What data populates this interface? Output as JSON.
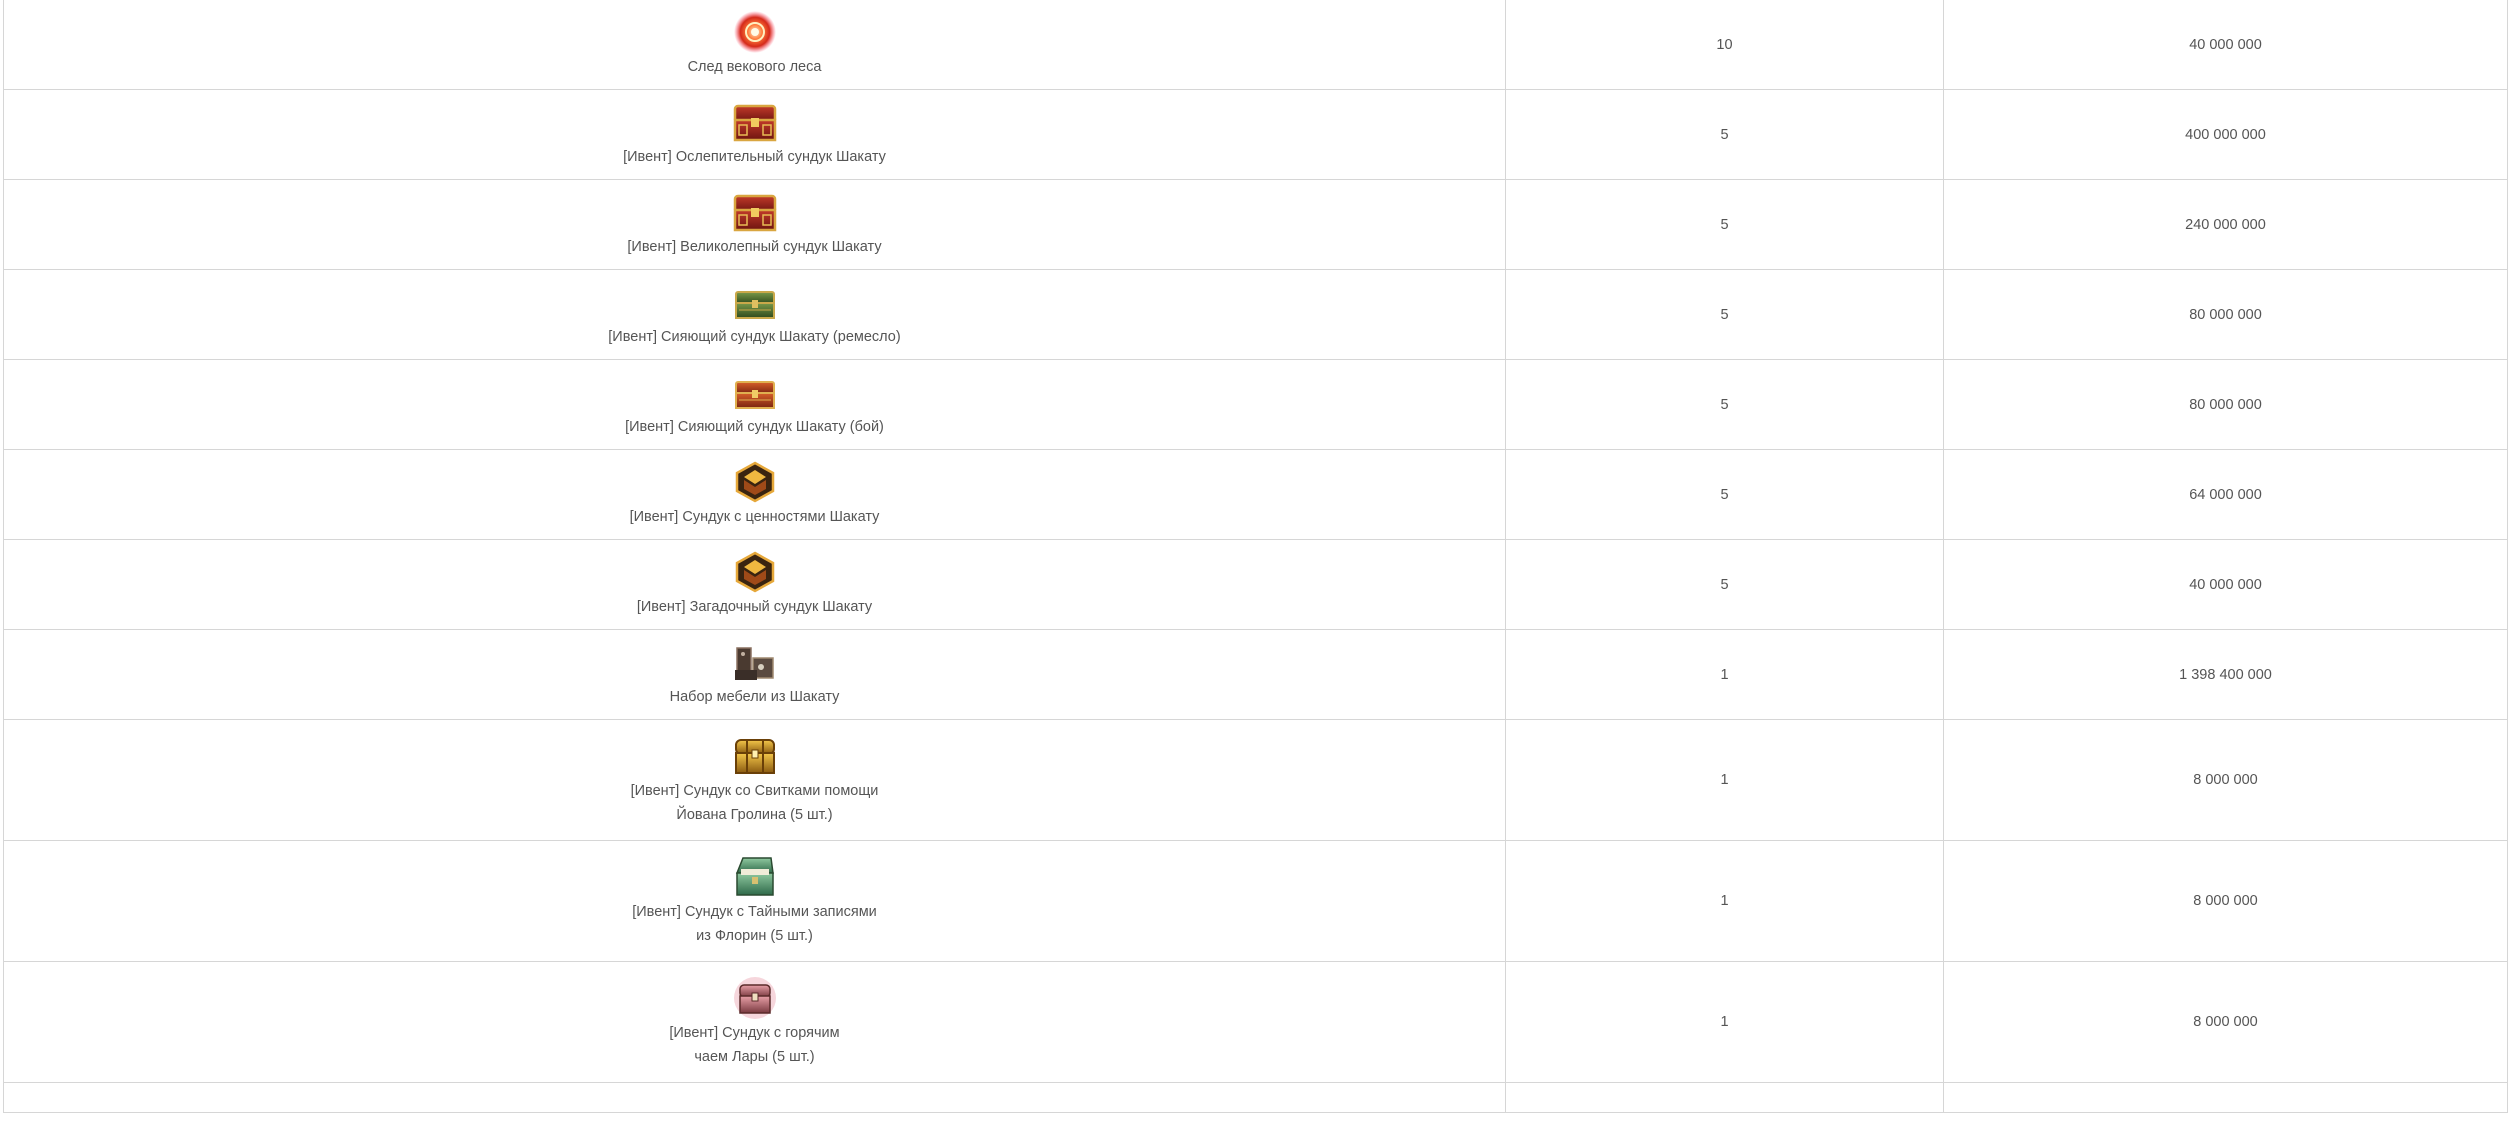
{
  "items": [
    {
      "name": "След векового леса",
      "name2": "",
      "qty": "10",
      "price": "40 000 000",
      "icon": "flame-orb-icon",
      "tall": false
    },
    {
      "name": "[Ивент] Ослепительный сундук Шакату",
      "name2": "",
      "qty": "5",
      "price": "400 000 000",
      "icon": "red-gold-chest-icon",
      "tall": false
    },
    {
      "name": "[Ивент] Великолепный сундук Шакату",
      "name2": "",
      "qty": "5",
      "price": "240 000 000",
      "icon": "red-gold-chest-icon",
      "tall": false
    },
    {
      "name": "[Ивент] Сияющий сундук Шакату (ремесло)",
      "name2": "",
      "qty": "5",
      "price": "80 000 000",
      "icon": "green-chest-icon",
      "tall": false
    },
    {
      "name": "[Ивент] Сияющий сундук Шакату (бой)",
      "name2": "",
      "qty": "5",
      "price": "80 000 000",
      "icon": "orange-chest-icon",
      "tall": false
    },
    {
      "name": "[Ивент] Сундук с ценностями Шакату",
      "name2": "",
      "qty": "5",
      "price": "64 000 000",
      "icon": "hex-chest-icon",
      "tall": false
    },
    {
      "name": "[Ивент] Загадочный сундук Шакату",
      "name2": "",
      "qty": "5",
      "price": "40 000 000",
      "icon": "hex-chest-icon",
      "tall": false
    },
    {
      "name": "Набор мебели из Шакату",
      "name2": "",
      "qty": "1",
      "price": "1 398 400 000",
      "icon": "furniture-set-icon",
      "tall": false
    },
    {
      "name": "[Ивент] Сундук со Свитками помощи",
      "name2": "Йована Гролина (5 шт.)",
      "qty": "1",
      "price": "8 000 000",
      "icon": "golden-chest-icon",
      "tall": true
    },
    {
      "name": "[Ивент] Сундук с Тайными записями",
      "name2": "из Флорин (5 шт.)",
      "qty": "1",
      "price": "8 000 000",
      "icon": "green-open-chest-icon",
      "tall": true
    },
    {
      "name": "[Ивент] Сундук с горячим",
      "name2": "чаем Лары (5 шт.)",
      "qty": "1",
      "price": "8 000 000",
      "icon": "pink-chest-icon",
      "tall": true
    }
  ]
}
